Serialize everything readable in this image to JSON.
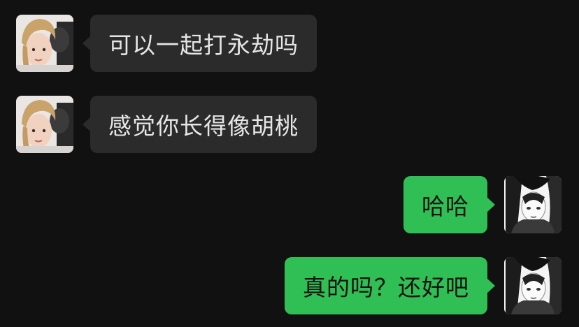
{
  "conversation": {
    "messages": [
      {
        "sender": "contact",
        "avatar": "contact-avatar",
        "text": "可以一起打永劫吗"
      },
      {
        "sender": "contact",
        "avatar": "contact-avatar",
        "text": "感觉你长得像胡桃"
      },
      {
        "sender": "me",
        "avatar": "self-avatar",
        "text": "哈哈"
      },
      {
        "sender": "me",
        "avatar": "self-avatar",
        "text": "真的吗？还好吧"
      }
    ]
  },
  "colors": {
    "background": "#111111",
    "incoming_bubble": "#2b2b2b",
    "outgoing_bubble": "#2fbf55",
    "incoming_text": "#e6e6e6",
    "outgoing_text": "#111111"
  }
}
